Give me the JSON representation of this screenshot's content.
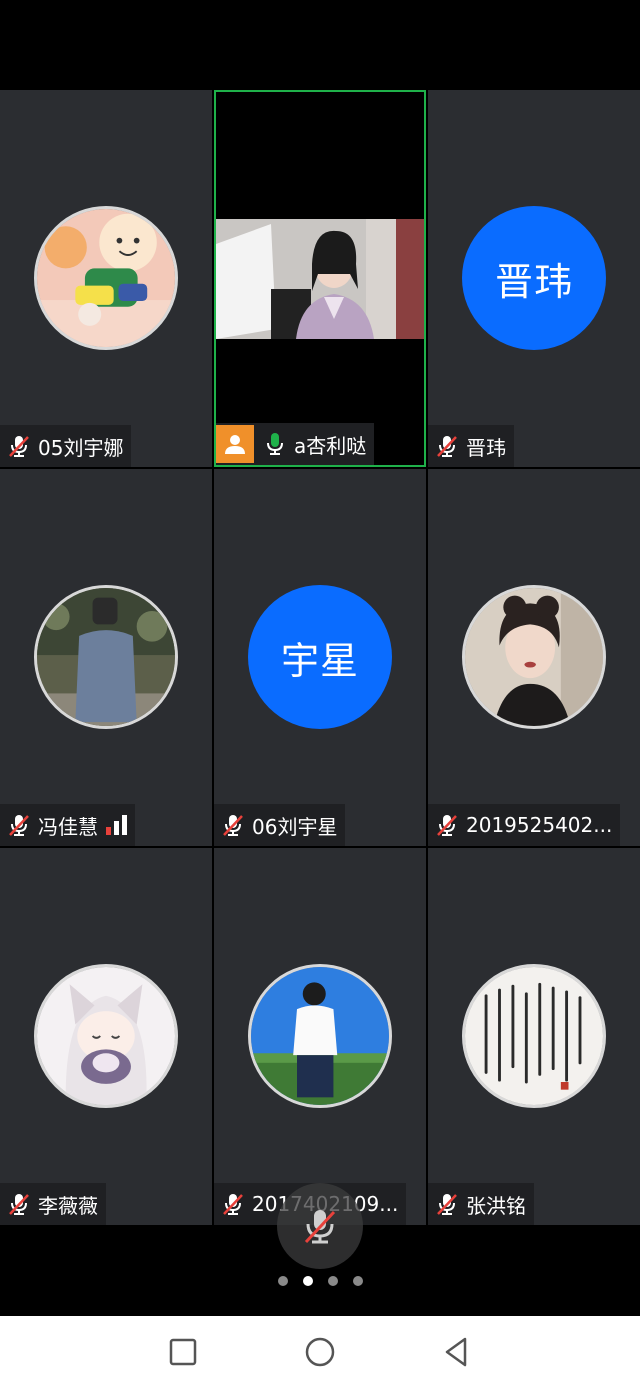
{
  "participants": [
    {
      "name": "05刘宇娜",
      "mic": "muted",
      "avatar": "toy-plush-photo"
    },
    {
      "name": "a杏利哒",
      "mic": "on",
      "host": true,
      "video": true
    },
    {
      "name": "晋玮",
      "mic": "muted",
      "initials": "晋玮"
    },
    {
      "name": "冯佳慧",
      "mic": "muted",
      "avatar": "person-hoodie-photo",
      "signal": true
    },
    {
      "name": "06刘宇星",
      "mic": "muted",
      "initials": "宇星"
    },
    {
      "name": "2019525402...",
      "mic": "muted",
      "avatar": "woman-portrait-photo"
    },
    {
      "name": "李薇薇",
      "mic": "muted",
      "avatar": "anime-cat-girl-drawing"
    },
    {
      "name": "2017402109...",
      "mic": "muted",
      "avatar": "person-back-sky-photo"
    },
    {
      "name": "张洪铭",
      "mic": "muted",
      "avatar": "calligraphy-photo"
    }
  ],
  "pager": {
    "total": 4,
    "current": 2
  },
  "colors": {
    "active_border": "#1fb14a",
    "initials_bg": "#0a6cff",
    "host_badge": "#f0902a",
    "mute_red": "#e8413b",
    "mic_green": "#1fb14a"
  },
  "icons": {
    "mic_muted": "mic-muted-icon",
    "mic_on": "mic-icon",
    "host": "person-icon",
    "signal": "signal-bars-icon"
  }
}
